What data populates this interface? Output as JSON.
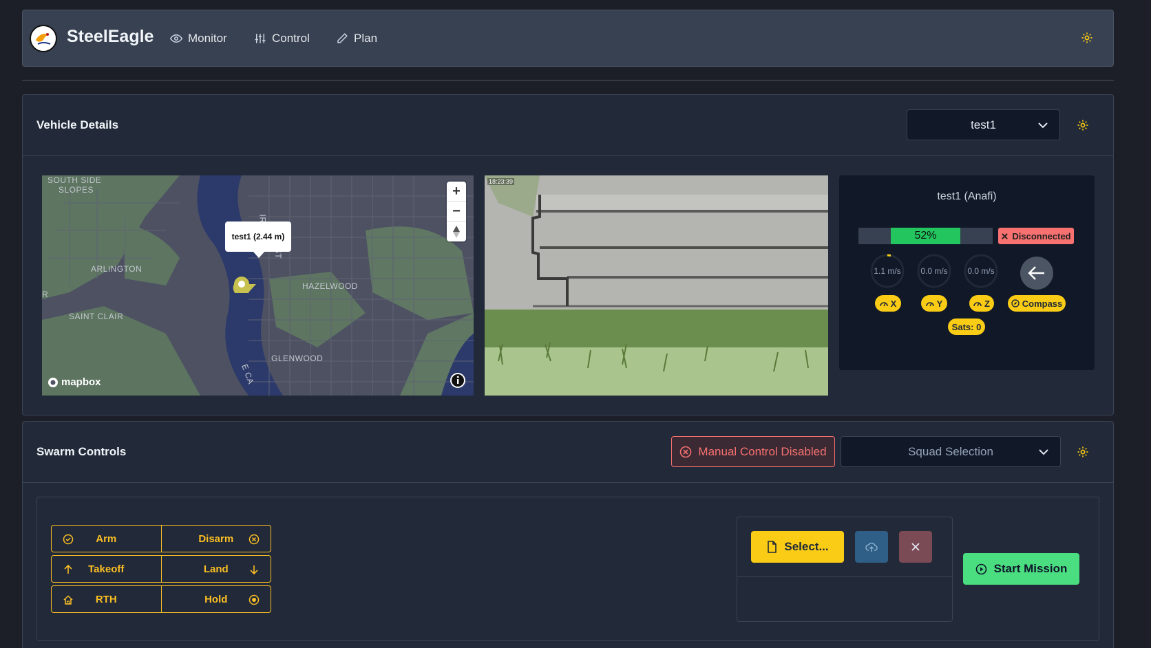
{
  "app": {
    "brand": "SteelEagle"
  },
  "nav": {
    "monitor": "Monitor",
    "control": "Control",
    "plan": "Plan"
  },
  "vehicle": {
    "title": "Vehicle Details",
    "selected": "test1",
    "name_model": "test1 (Anafi)",
    "battery_pct": 52,
    "battery_label": "52%",
    "status": "Disconnected",
    "speed_x": "1.1 m/s",
    "speed_y": "0.0 m/s",
    "speed_z": "0.0 m/s",
    "badge_x": "X",
    "badge_y": "Y",
    "badge_z": "Z",
    "badge_compass": "Compass",
    "sats": "Sats: 0"
  },
  "map": {
    "labels": {
      "south_side_1": "SOUTH SIDE",
      "south_side_2": "SLOPES",
      "arlington": "ARLINGTON",
      "hazelwood": "HAZELWOOD",
      "saint_clair": "SAINT CLAIR",
      "glenwood": "GLENWOOD",
      "east_car": "E CA",
      "irvine": "IR",
      "street": "ST",
      "edge": "r"
    },
    "popup": "test1 (2.44 m)",
    "attribution": "mapbox",
    "zoom_in": "+",
    "zoom_out": "−"
  },
  "camera": {
    "timestamp": "18:23:39"
  },
  "swarm": {
    "title": "Swarm Controls",
    "manual_status": "Manual Control Disabled",
    "squad_placeholder": "Squad Selection",
    "arm": "Arm",
    "disarm": "Disarm",
    "takeoff": "Takeoff",
    "land": "Land",
    "rth": "RTH",
    "hold": "Hold",
    "select": "Select...",
    "start_mission": "Start Mission"
  },
  "colors": {
    "accent_yellow": "#facc15",
    "success_green": "#4ade80",
    "danger_red": "#f87171",
    "upload_blue": "#2f5f86"
  }
}
